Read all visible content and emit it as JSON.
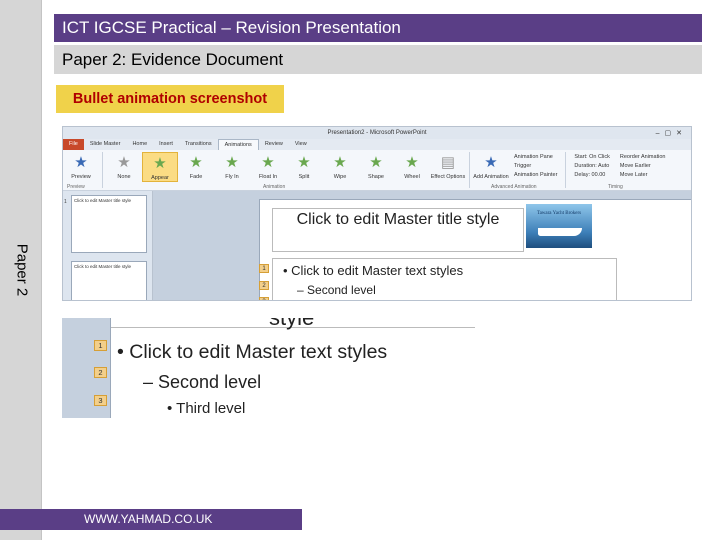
{
  "colors": {
    "purple": "#5a3e86",
    "gray": "#d6d6d6",
    "yellow": "#f0d24a",
    "caption_text": "#b00000"
  },
  "header": {
    "title": "ICT IGCSE Practical – Revision Presentation",
    "subtitle": "Paper 2: Evidence Document"
  },
  "caption": "Bullet animation screenshot",
  "side_label": "Paper 2",
  "powerpoint": {
    "window_title": "Presentation2 - Microsoft PowerPoint",
    "tabs": [
      "File",
      "Slide Master",
      "Home",
      "Insert",
      "Transitions",
      "Animations",
      "Review",
      "View"
    ],
    "active_tab": "Animations",
    "animations": [
      {
        "label": "Preview",
        "icon": "star-icon"
      },
      {
        "label": "None",
        "icon": "star-icon"
      },
      {
        "label": "Appear",
        "icon": "star-icon"
      },
      {
        "label": "Fade",
        "icon": "star-icon"
      },
      {
        "label": "Fly In",
        "icon": "star-icon"
      },
      {
        "label": "Float In",
        "icon": "star-icon"
      },
      {
        "label": "Split",
        "icon": "star-icon"
      },
      {
        "label": "Wipe",
        "icon": "star-icon"
      },
      {
        "label": "Shape",
        "icon": "star-icon"
      },
      {
        "label": "Wheel",
        "icon": "star-icon"
      }
    ],
    "selected_animation": "Appear",
    "effect_options": "Effect Options",
    "add_animation": "Add Animation",
    "advanced": [
      "Animation Pane",
      "Trigger",
      "Animation Painter"
    ],
    "timing": {
      "start_label": "Start:",
      "start_value": "On Click",
      "duration_label": "Duration:",
      "duration_value": "Auto",
      "delay_label": "Delay:",
      "delay_value": "00.00"
    },
    "reorder": [
      "Reorder Animation",
      "Move Earlier",
      "Move Later"
    ],
    "groups": [
      "Preview",
      "Animation",
      "Advanced Animation",
      "Timing"
    ],
    "thumb_text": [
      "Click to edit Master title style",
      "Click to edit Master title style"
    ],
    "slide": {
      "title": "Click to edit Master title style",
      "logo_text": "Tawara Yacht Brokers",
      "bullet1": "Click to edit Master text styles",
      "bullet2": "Second level",
      "numbers": [
        "1",
        "2",
        "3"
      ]
    }
  },
  "zoomed": {
    "title_fragment": "style",
    "bullet1": "Click to edit Master text styles",
    "bullet2": "Second level",
    "bullet3": "Third level",
    "numbers": [
      "1",
      "2",
      "3"
    ]
  },
  "footer": {
    "url": "WWW.YAHMAD.CO.UK"
  }
}
